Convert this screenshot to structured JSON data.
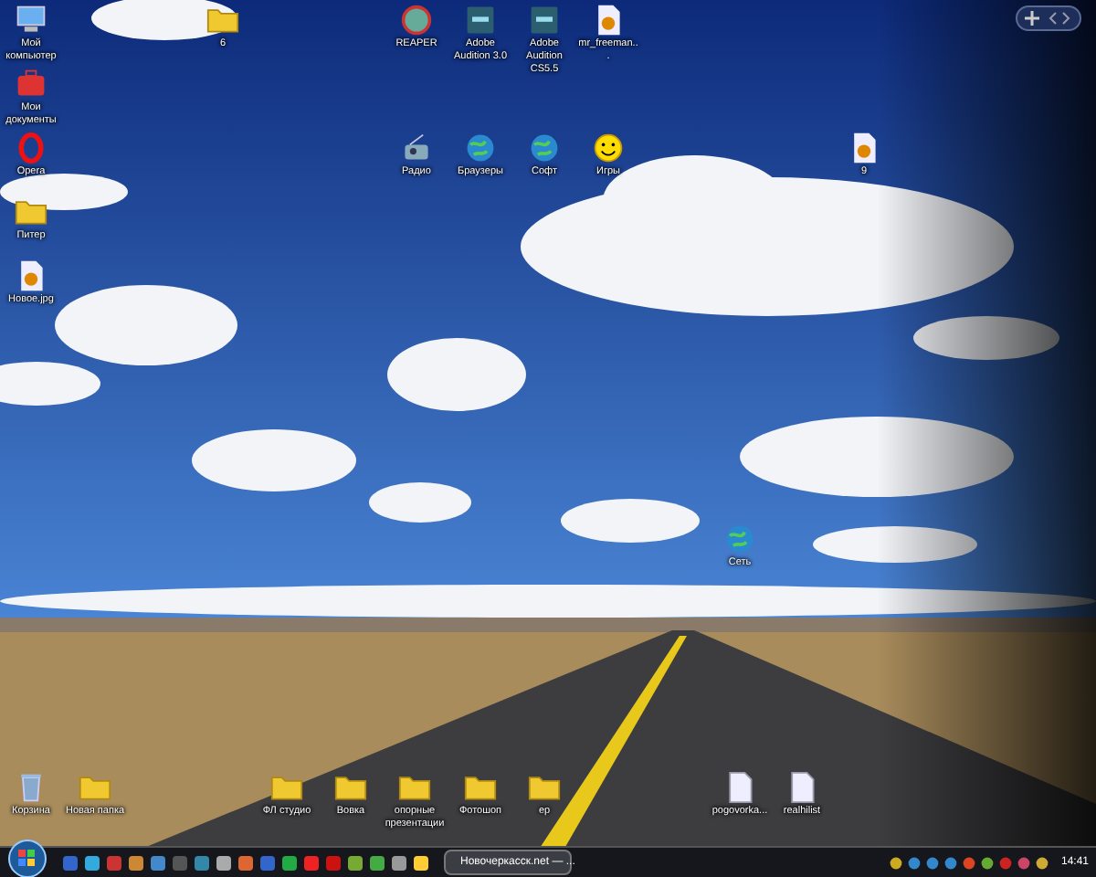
{
  "desktop_icons": [
    {
      "kind": "computer",
      "label": "Мой компьютер"
    },
    {
      "kind": "folder",
      "label": "6"
    },
    {
      "kind": "reaper",
      "label": "REAPER"
    },
    {
      "kind": "audition",
      "label": "Adobe Audition 3.0"
    },
    {
      "kind": "audition",
      "label": "Adobe Audition CS5.5"
    },
    {
      "kind": "image",
      "label": "mr_freeman..."
    },
    {
      "kind": "documents",
      "label": "Мои документы"
    },
    {
      "kind": "opera",
      "label": "Opera"
    },
    {
      "kind": "radio",
      "label": "Радио"
    },
    {
      "kind": "globe",
      "label": "Браузеры"
    },
    {
      "kind": "globe",
      "label": "Софт"
    },
    {
      "kind": "smiley",
      "label": "Игры"
    },
    {
      "kind": "image",
      "label": "9"
    },
    {
      "kind": "folder",
      "label": "Питер"
    },
    {
      "kind": "image",
      "label": "Новое.jpg"
    },
    {
      "kind": "globe",
      "label": "Сеть"
    },
    {
      "kind": "recycle",
      "label": "Корзина"
    },
    {
      "kind": "folder",
      "label": "Новая папка"
    },
    {
      "kind": "folder",
      "label": "ФЛ студио"
    },
    {
      "kind": "folder",
      "label": "Вовка"
    },
    {
      "kind": "folder",
      "label": "опорные презентации"
    },
    {
      "kind": "folder",
      "label": "Фотошоп"
    },
    {
      "kind": "folder",
      "label": "ер"
    },
    {
      "kind": "file",
      "label": "pogovorka..."
    },
    {
      "kind": "file",
      "label": "realhilist"
    }
  ],
  "taskbar": {
    "task": {
      "label": "Новочеркасск.net — ...",
      "selected": true
    },
    "clock": "14:41"
  }
}
